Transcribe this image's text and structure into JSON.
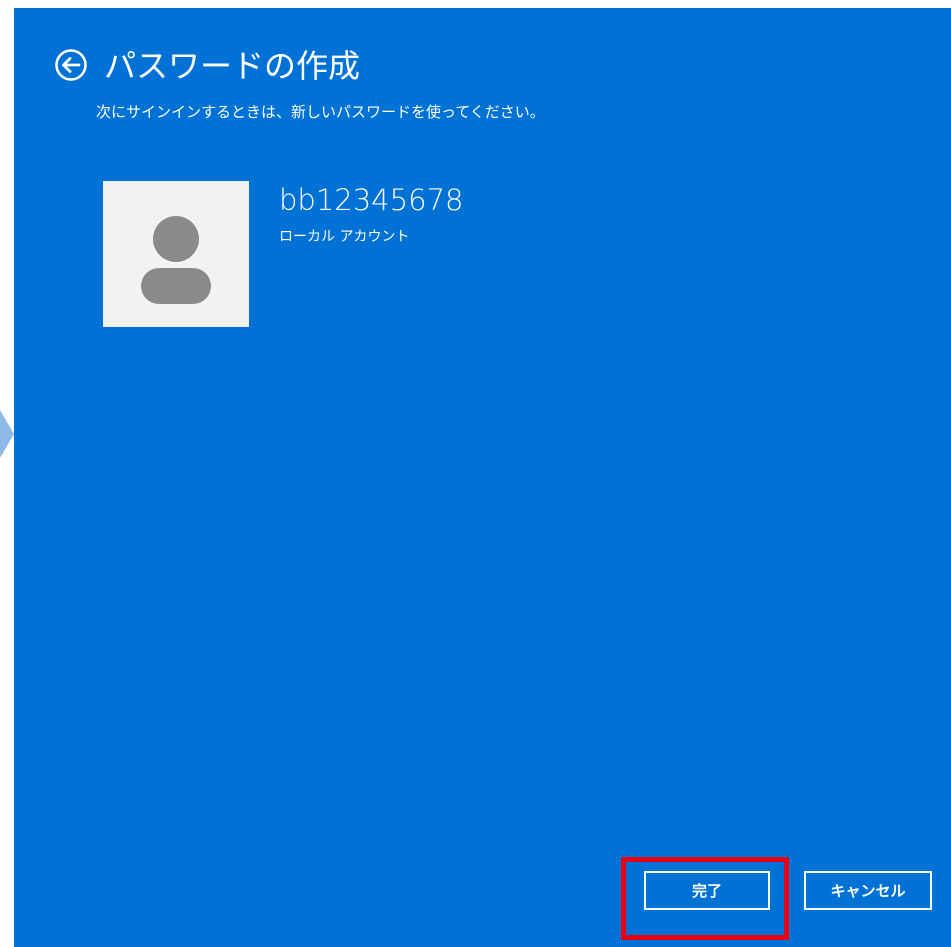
{
  "window": {
    "title": "パスワードの作成",
    "subtitle": "次にサインインするときは、新しいパスワードを使ってください。"
  },
  "back_button": {
    "icon": "back-arrow-circle-icon"
  },
  "account": {
    "username": "bb12345678",
    "type": "ローカル アカウント",
    "avatar_icon": "user-silhouette-icon"
  },
  "buttons": {
    "finish_label": "完了",
    "cancel_label": "キャンセル"
  },
  "colors": {
    "background": "#0072d6",
    "highlight": "#e60012",
    "avatar_bg": "#f2f2f2",
    "avatar_fg": "#8a8a8a"
  }
}
